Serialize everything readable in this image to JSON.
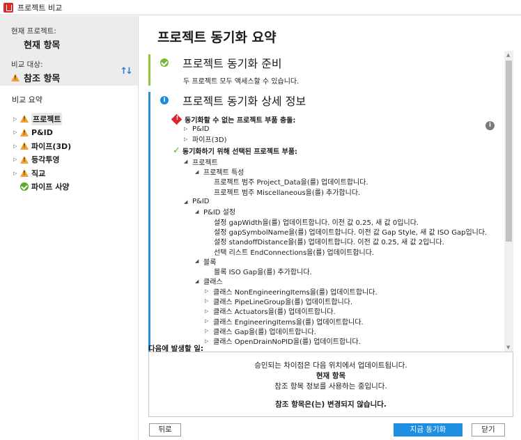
{
  "window": {
    "title": "프로젝트 비교"
  },
  "left": {
    "current_project_label": "현재 프로젝트:",
    "current_project_value": "현재 항목",
    "compare_target_label": "비교 대상:",
    "compare_target_value": "참조 항목",
    "summary_label": "비교 요약",
    "items": [
      {
        "label": "프로젝트",
        "status": "warning",
        "selected": true
      },
      {
        "label": "P&ID",
        "status": "warning"
      },
      {
        "label": "파이프(3D)",
        "status": "warning"
      },
      {
        "label": "등각투영",
        "status": "warning"
      },
      {
        "label": "직교",
        "status": "warning"
      },
      {
        "label": "파이프 사양",
        "status": "ok"
      }
    ]
  },
  "main": {
    "title": "프로젝트 동기화 요약",
    "section1": {
      "title": "프로젝트 동기화 준비",
      "desc": "두 프로젝트 모두 액세스할 수 있습니다."
    },
    "section2": {
      "title": "프로젝트 동기화 상세 정보",
      "conflict_header": "동기화할 수 없는 프로젝트 부품 충돌:",
      "conflicts": [
        "P&ID",
        "파이프(3D)"
      ],
      "selected_header": "동기화하기 위해 선택된 프로젝트 부품:",
      "tree": {
        "project": "프로젝트",
        "project_props": "프로젝트 특성",
        "pp1": "프로젝트 범주 Project_Data을(를) 업데이트합니다.",
        "pp2": "프로젝트 범주 Miscellaneous을(를) 추가합니다.",
        "pid": "P&ID",
        "pid_settings": "P&ID 설정",
        "ps1": "설정 gapWidth을(를) 업데이트합니다. 이전 값 0.25, 새 값 0입니다.",
        "ps2": "설정 gapSymbolName을(를) 업데이트합니다. 이전 값 Gap Style, 새 값 ISO Gap입니다.",
        "ps3": "설정 standoffDistance을(를) 업데이트합니다. 이전 값 0.25, 새 값 2입니다.",
        "ps4": "선택 리스트 EndConnections을(를) 업데이트합니다.",
        "blocks": "블록",
        "b1": "블록 ISO Gap을(를) 추가합니다.",
        "classes": "클래스",
        "c1": "클래스 NonEngineeringItems을(를) 업데이트합니다.",
        "c2": "클래스 PipeLineGroup을(를) 업데이트합니다.",
        "c3": "클래스 Actuators을(를) 업데이트합니다.",
        "c4": "클래스 EngineeringItems을(를) 업데이트합니다.",
        "c5": "클래스 Gap을(를) 업데이트합니다.",
        "c6": "클래스 OpenDrainNoPID을(를) 업데이트합니다."
      }
    },
    "next_label": "다음에 발생할 일:",
    "next": {
      "line1": "승인되는 차이점은 다음 위치에서 업데이트됩니다.",
      "line2": "현재 항목",
      "line3": "참조 항목 정보를 사용하는 중입니다.",
      "line4": "참조 항목은(는) 변경되지 않습니다."
    },
    "buttons": {
      "back": "뒤로",
      "sync": "지금 동기화",
      "close": "닫기"
    }
  },
  "colors": {
    "accent_blue": "#1e8ee0",
    "ok_green": "#7ab834",
    "warning": "#f2a12e",
    "error": "#d9262b"
  }
}
